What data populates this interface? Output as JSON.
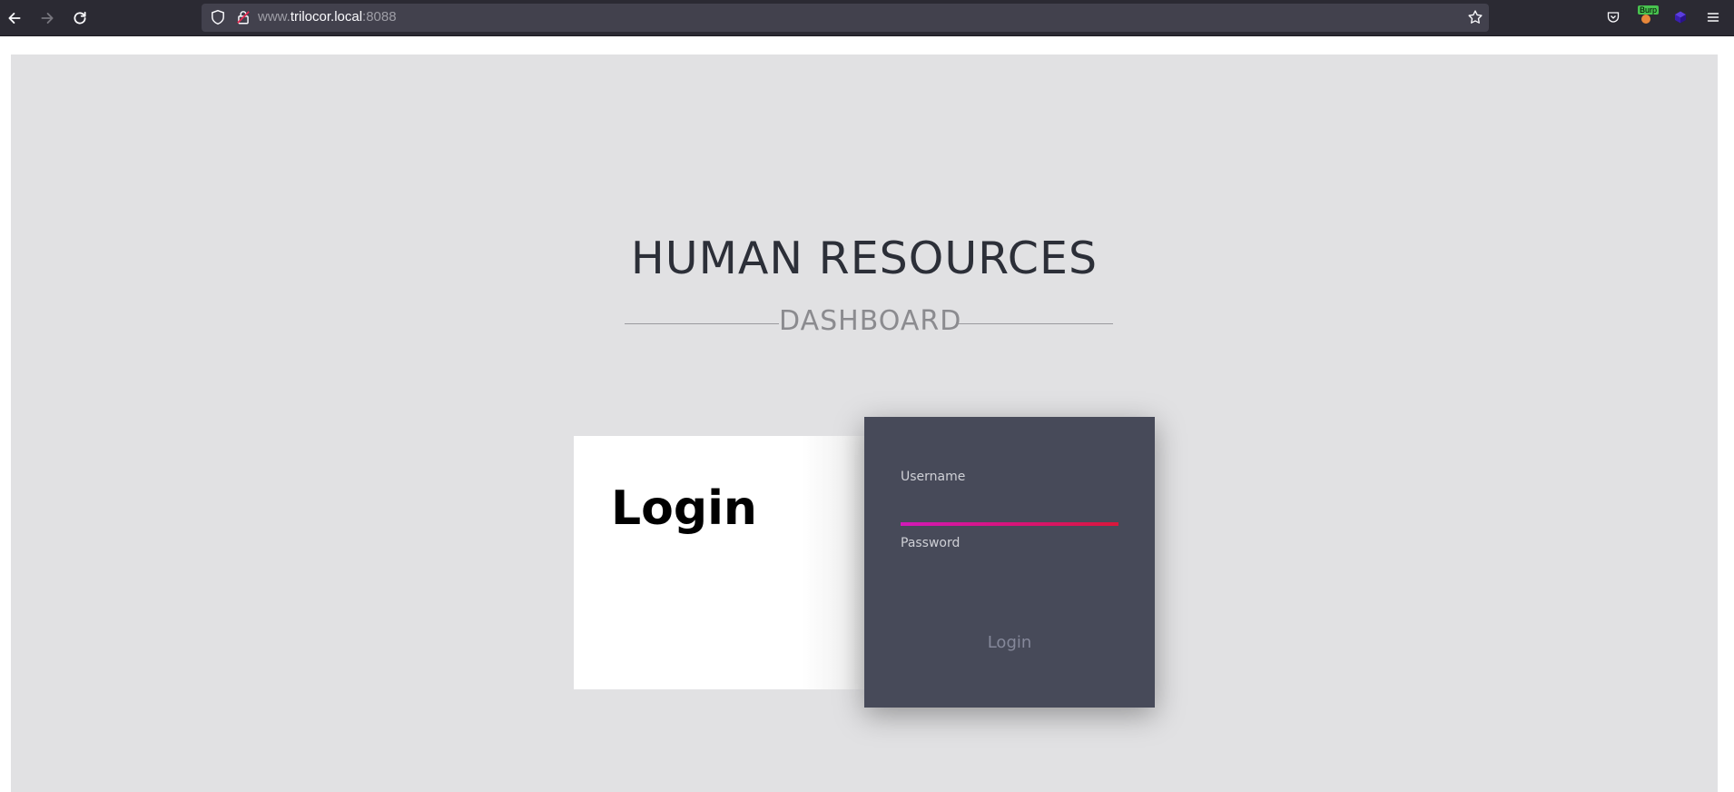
{
  "browser": {
    "url_prefix": "www.",
    "url_host": "trilocor.local",
    "url_port": ":8088",
    "extension_badge": "Burp"
  },
  "page": {
    "title": "HUMAN RESOURCES",
    "subtitle": "DASHBOARD",
    "card_heading": "Login",
    "form": {
      "username_label": "Username",
      "username_value": "",
      "password_label": "Password",
      "password_value": "",
      "submit_label": "Login"
    }
  },
  "colors": {
    "page_background": "#e1e1e3",
    "form_background": "#474a59",
    "accent_gradient_start": "#d21ab8",
    "accent_gradient_end": "#d9173a"
  }
}
